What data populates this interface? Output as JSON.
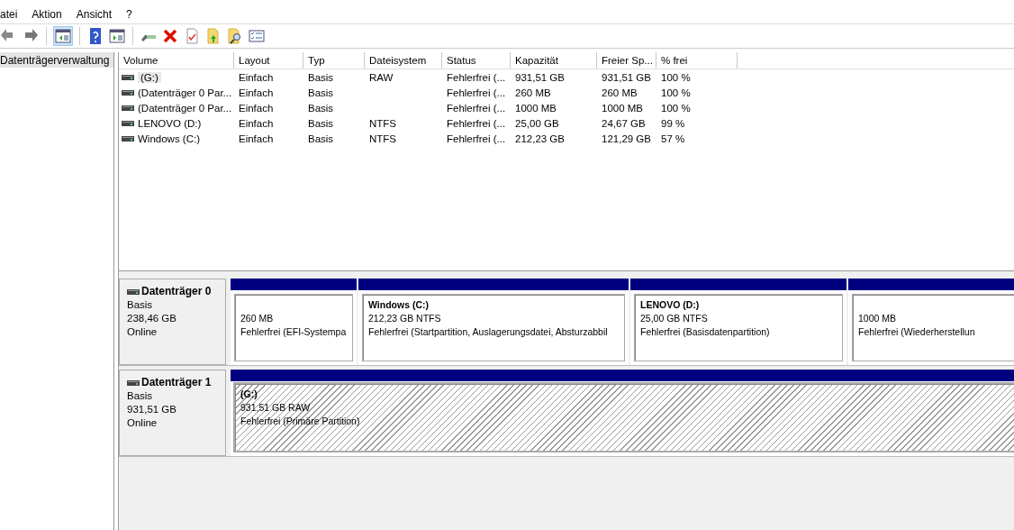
{
  "menu": [
    "atei",
    "Aktion",
    "Ansicht",
    "?"
  ],
  "toolbar": [
    [
      {
        "kind": "back"
      },
      {
        "kind": "forward"
      }
    ],
    [
      {
        "kind": "console"
      }
    ],
    [
      {
        "kind": "help"
      },
      {
        "kind": "panel"
      }
    ],
    [
      {
        "kind": "drive"
      },
      {
        "kind": "delete"
      },
      {
        "kind": "check"
      },
      {
        "kind": "folder-up"
      },
      {
        "kind": "folder-search"
      },
      {
        "kind": "list"
      }
    ]
  ],
  "tree": {
    "label": "Datenträgerverwaltung",
    "selected": true
  },
  "table": {
    "columns": [
      "Volume",
      "Layout",
      "Typ",
      "Dateisystem",
      "Status",
      "Kapazität",
      "Freier Sp...",
      "% frei"
    ],
    "rows": [
      {
        "selected": true,
        "cells": [
          "(G:)",
          "Einfach",
          "Basis",
          "RAW",
          "Fehlerfrei (...",
          "931,51 GB",
          "931,51 GB",
          "100 %"
        ]
      },
      {
        "selected": false,
        "cells": [
          "(Datenträger 0 Par...",
          "Einfach",
          "Basis",
          "",
          "Fehlerfrei (...",
          "260 MB",
          "260 MB",
          "100 %"
        ]
      },
      {
        "selected": false,
        "cells": [
          "(Datenträger 0 Par...",
          "Einfach",
          "Basis",
          "",
          "Fehlerfrei (...",
          "1000 MB",
          "1000 MB",
          "100 %"
        ]
      },
      {
        "selected": false,
        "cells": [
          "LENOVO (D:)",
          "Einfach",
          "Basis",
          "NTFS",
          "Fehlerfrei (...",
          "25,00 GB",
          "24,67 GB",
          "99 %"
        ]
      },
      {
        "selected": false,
        "cells": [
          "Windows (C:)",
          "Einfach",
          "Basis",
          "NTFS",
          "Fehlerfrei (...",
          "212,23 GB",
          "121,29 GB",
          "57 %"
        ]
      }
    ]
  },
  "disks": [
    {
      "name": "Datenträger 0",
      "type": "Basis",
      "size": "238,46 GB",
      "state": "Online",
      "partitions": [
        {
          "size": "260 MB",
          "status": "Fehlerfrei (EFI-Systempa",
          "selected": false
        },
        {
          "title": "Windows  (C:)",
          "size": "212,23 GB NTFS",
          "status": "Fehlerfrei (Startpartition, Auslagerungsdatei, Absturzabbil",
          "selected": false
        },
        {
          "title": "LENOVO  (D:)",
          "size": "25,00 GB NTFS",
          "status": "Fehlerfrei (Basisdatenpartition)",
          "selected": false
        },
        {
          "size": "1000 MB",
          "status": "Fehlerfrei (Wiederherstellun",
          "selected": false
        }
      ]
    },
    {
      "name": "Datenträger 1",
      "type": "Basis",
      "size": "931,51 GB",
      "state": "Online",
      "partitions": [
        {
          "title": " (G:)",
          "size": "931,51 GB RAW",
          "status": "Fehlerfrei (Primäre Partition)",
          "selected": true
        }
      ]
    }
  ]
}
